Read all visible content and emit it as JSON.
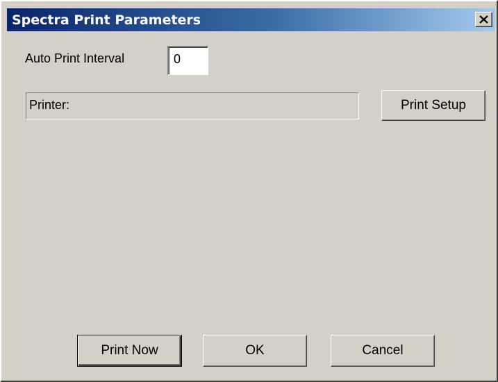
{
  "window": {
    "title": "Spectra Print Parameters"
  },
  "icons": {
    "close": "close-icon"
  },
  "auto_print": {
    "label": "Auto Print Interval",
    "value": "0"
  },
  "printer": {
    "label": "Printer:"
  },
  "buttons": {
    "print_setup": "Print Setup",
    "print_now": "Print Now",
    "ok": "OK",
    "cancel": "Cancel"
  },
  "colors": {
    "titlebar_start": "#0a246a",
    "titlebar_end": "#a6caf0",
    "dialog_face": "#d4d0c8"
  }
}
